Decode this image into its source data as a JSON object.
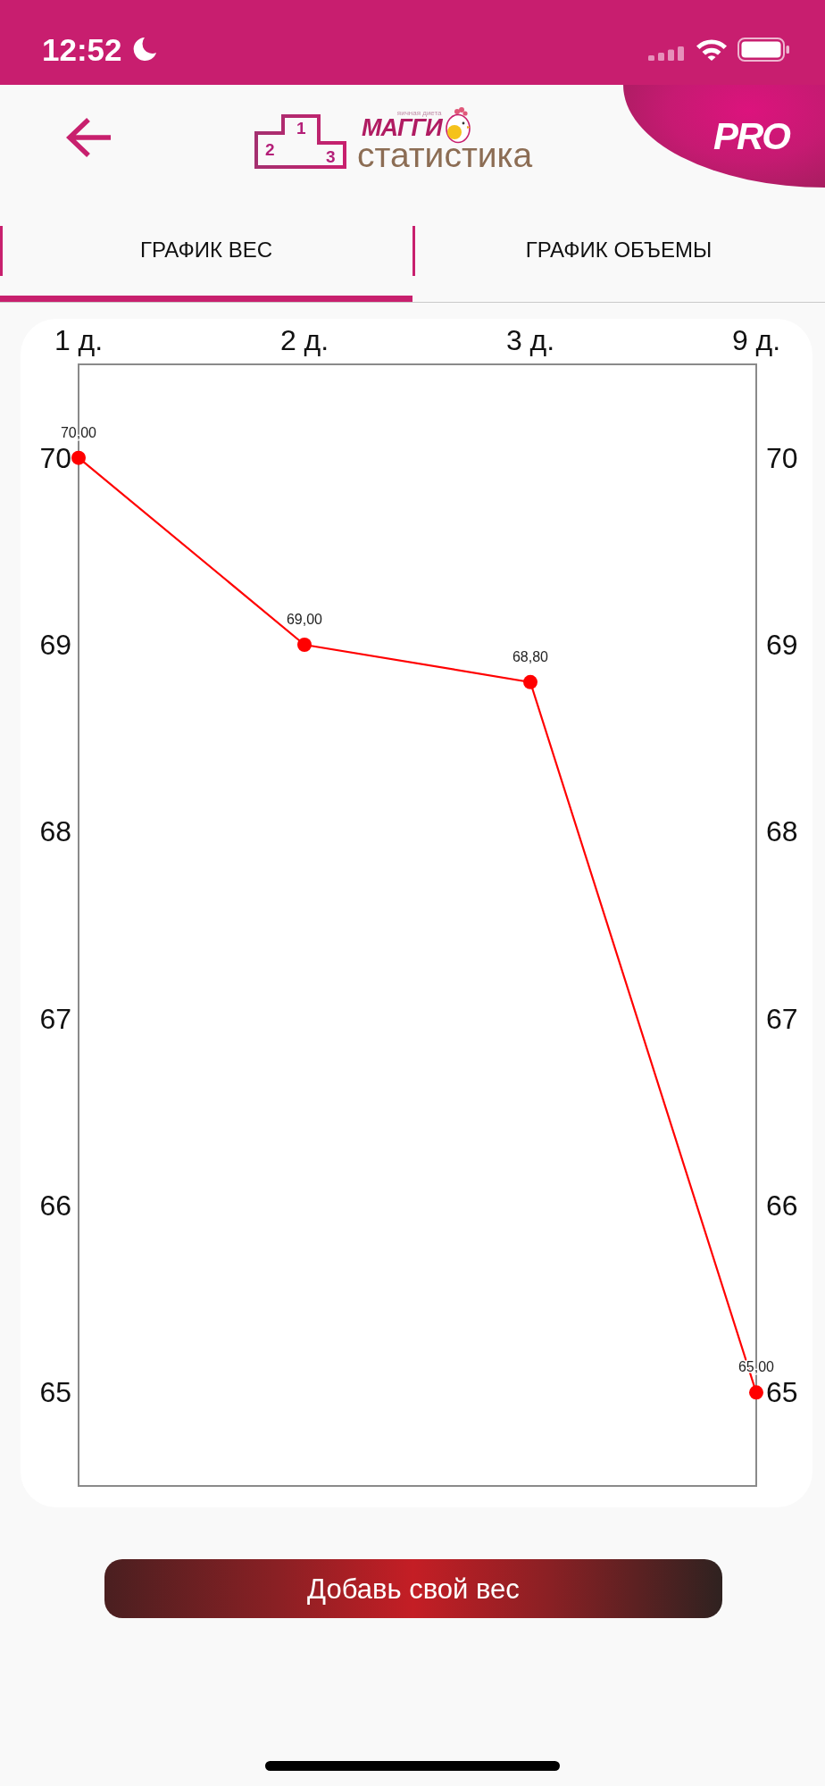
{
  "status_bar": {
    "time": "12:52"
  },
  "header": {
    "logo": {
      "podium": [
        "2",
        "1",
        "3"
      ],
      "tagline": "яичная диета",
      "brand": "МАГГИ",
      "subtitle": "статистика"
    },
    "badge": "PRO"
  },
  "tabs": [
    {
      "label": "ГРАФИК ВЕС",
      "selected": true
    },
    {
      "label": "ГРАФИК ОБЪЕМЫ",
      "selected": false
    }
  ],
  "chart": {
    "chart_data": {
      "type": "line",
      "categories": [
        "1 д.",
        "2 д.",
        "3 д.",
        "9 д."
      ],
      "series": [
        {
          "color": "#ff0000",
          "marker": "circle",
          "values": [
            70,
            69,
            68.8,
            65
          ]
        }
      ],
      "ylim": [
        64.5,
        70.5
      ],
      "yticks": [
        65,
        66,
        67,
        68,
        69,
        70
      ],
      "y2lim": [
        64.5,
        70.5
      ],
      "y2ticks": [
        65,
        66,
        67,
        68,
        69,
        70
      ],
      "value_labels": [
        "70,00",
        "69,00",
        "68,80",
        "65,00"
      ]
    }
  },
  "add_button": {
    "label": "Добавь свой вес"
  }
}
